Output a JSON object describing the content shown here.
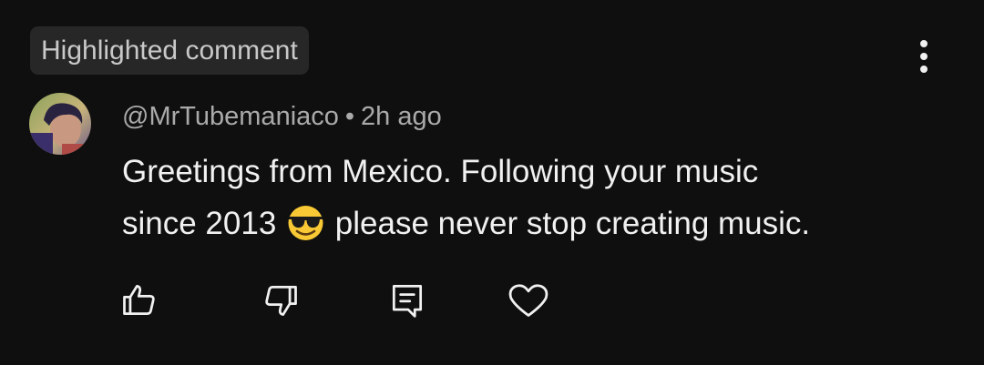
{
  "badge": {
    "label": "Highlighted comment"
  },
  "comment": {
    "author": "@MrTubemaniaco",
    "separator": "•",
    "timestamp": "2h ago",
    "text_line1": "Greetings from Mexico. Following your music",
    "text_line2_before": "since 2013",
    "emoji": "smiling-face-with-sunglasses",
    "text_line2_after": "please never stop creating music."
  },
  "actions": [
    {
      "icon": "thumbs-up-icon"
    },
    {
      "icon": "thumbs-down-icon"
    },
    {
      "icon": "reply-icon"
    },
    {
      "icon": "heart-icon"
    }
  ],
  "menu": {
    "icon": "more-vertical-icon"
  },
  "colors": {
    "background": "#0f0f0f",
    "badge_bg": "#272727",
    "text_primary": "#f1f1f1",
    "text_secondary": "#aaaaaa"
  }
}
